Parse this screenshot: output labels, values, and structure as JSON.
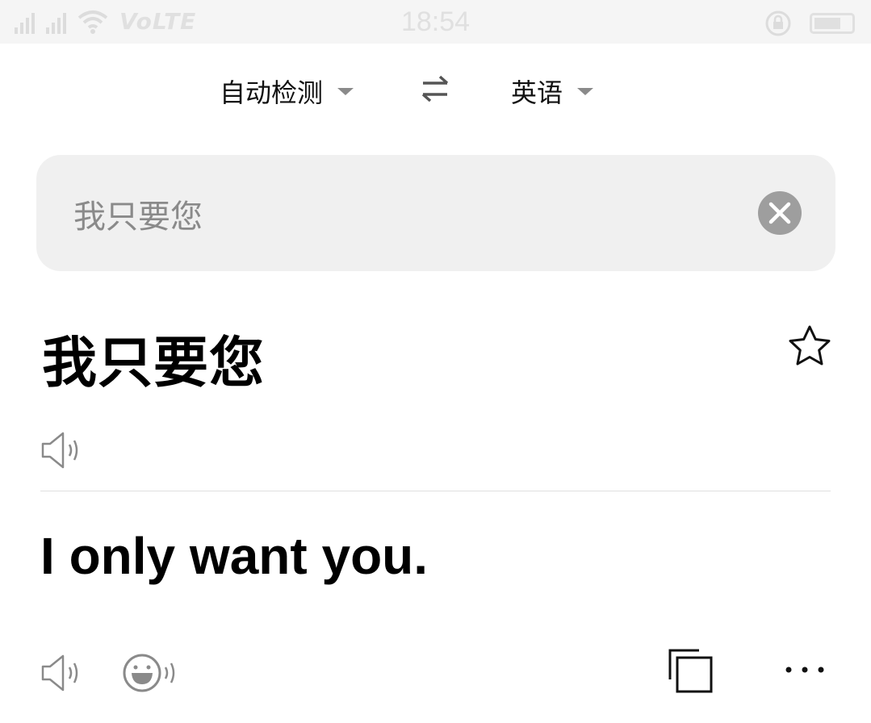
{
  "status_bar": {
    "network": "VoLTE",
    "time": "18:54"
  },
  "language_bar": {
    "source_language": "自动检测",
    "target_language": "英语"
  },
  "input": {
    "text": "我只要您"
  },
  "source": {
    "text": "我只要您"
  },
  "translation": {
    "text": "I only want you."
  },
  "icons": {
    "swap": "swap-arrows-icon",
    "clear": "clear-icon",
    "favorite": "star-icon",
    "speak_source": "speaker-icon",
    "speak_target": "speaker-icon",
    "voice_style": "smiley-speaker-icon",
    "copy": "copy-icon",
    "more": "more-icon"
  }
}
